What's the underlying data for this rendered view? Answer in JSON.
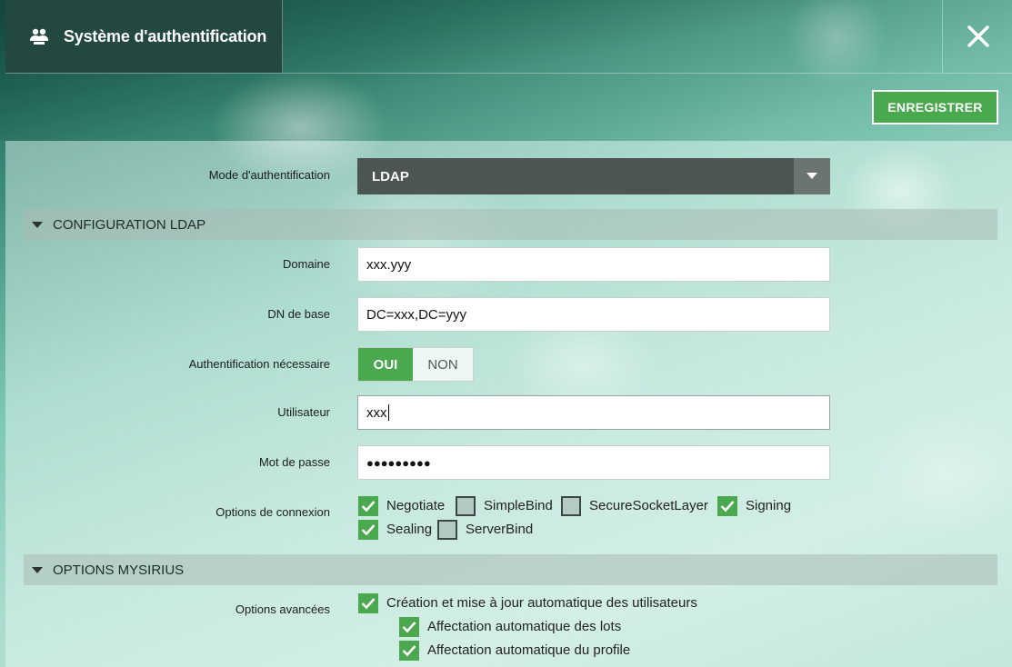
{
  "window": {
    "title": "Système d'authentification",
    "title_icon": "users-icon",
    "close_icon": "close-icon"
  },
  "toolbar": {
    "save_label": "ENREGISTRER"
  },
  "form": {
    "auth_mode": {
      "label": "Mode d'authentification",
      "value": "LDAP"
    },
    "ldap_section": {
      "title": "CONFIGURATION LDAP",
      "domain": {
        "label": "Domaine",
        "value": "xxx.yyy"
      },
      "base_dn": {
        "label": "DN de base",
        "value": "DC=xxx,DC=yyy"
      },
      "auth_required": {
        "label": "Authentification nécessaire",
        "on_label": "OUI",
        "off_label": "NON",
        "selected": "OUI"
      },
      "user": {
        "label": "Utilisateur",
        "value": "xxx"
      },
      "password": {
        "label": "Mot de passe",
        "value": "●●●●●●●●●"
      },
      "connection_options": {
        "label": "Options de connexion",
        "items": [
          {
            "label": "Negotiate",
            "checked": true
          },
          {
            "label": "SimpleBind",
            "checked": false
          },
          {
            "label": "SecureSocketLayer",
            "checked": false
          },
          {
            "label": "Signing",
            "checked": true
          },
          {
            "label": "Sealing",
            "checked": true
          },
          {
            "label": "ServerBind",
            "checked": false
          }
        ]
      }
    },
    "mysirius_section": {
      "title": "OPTIONS MYSIRIUS",
      "advanced": {
        "label": "Options avancées",
        "items": [
          {
            "label": "Création et mise à jour automatique des utilisateurs",
            "checked": true
          },
          {
            "label": "Affectation automatique des lots",
            "checked": true
          },
          {
            "label": "Affectation automatique du profile",
            "checked": true
          }
        ]
      }
    }
  },
  "colors": {
    "accent": "#4aa84e",
    "title_bg": "#22483f",
    "select_bg": "#4d5552"
  }
}
